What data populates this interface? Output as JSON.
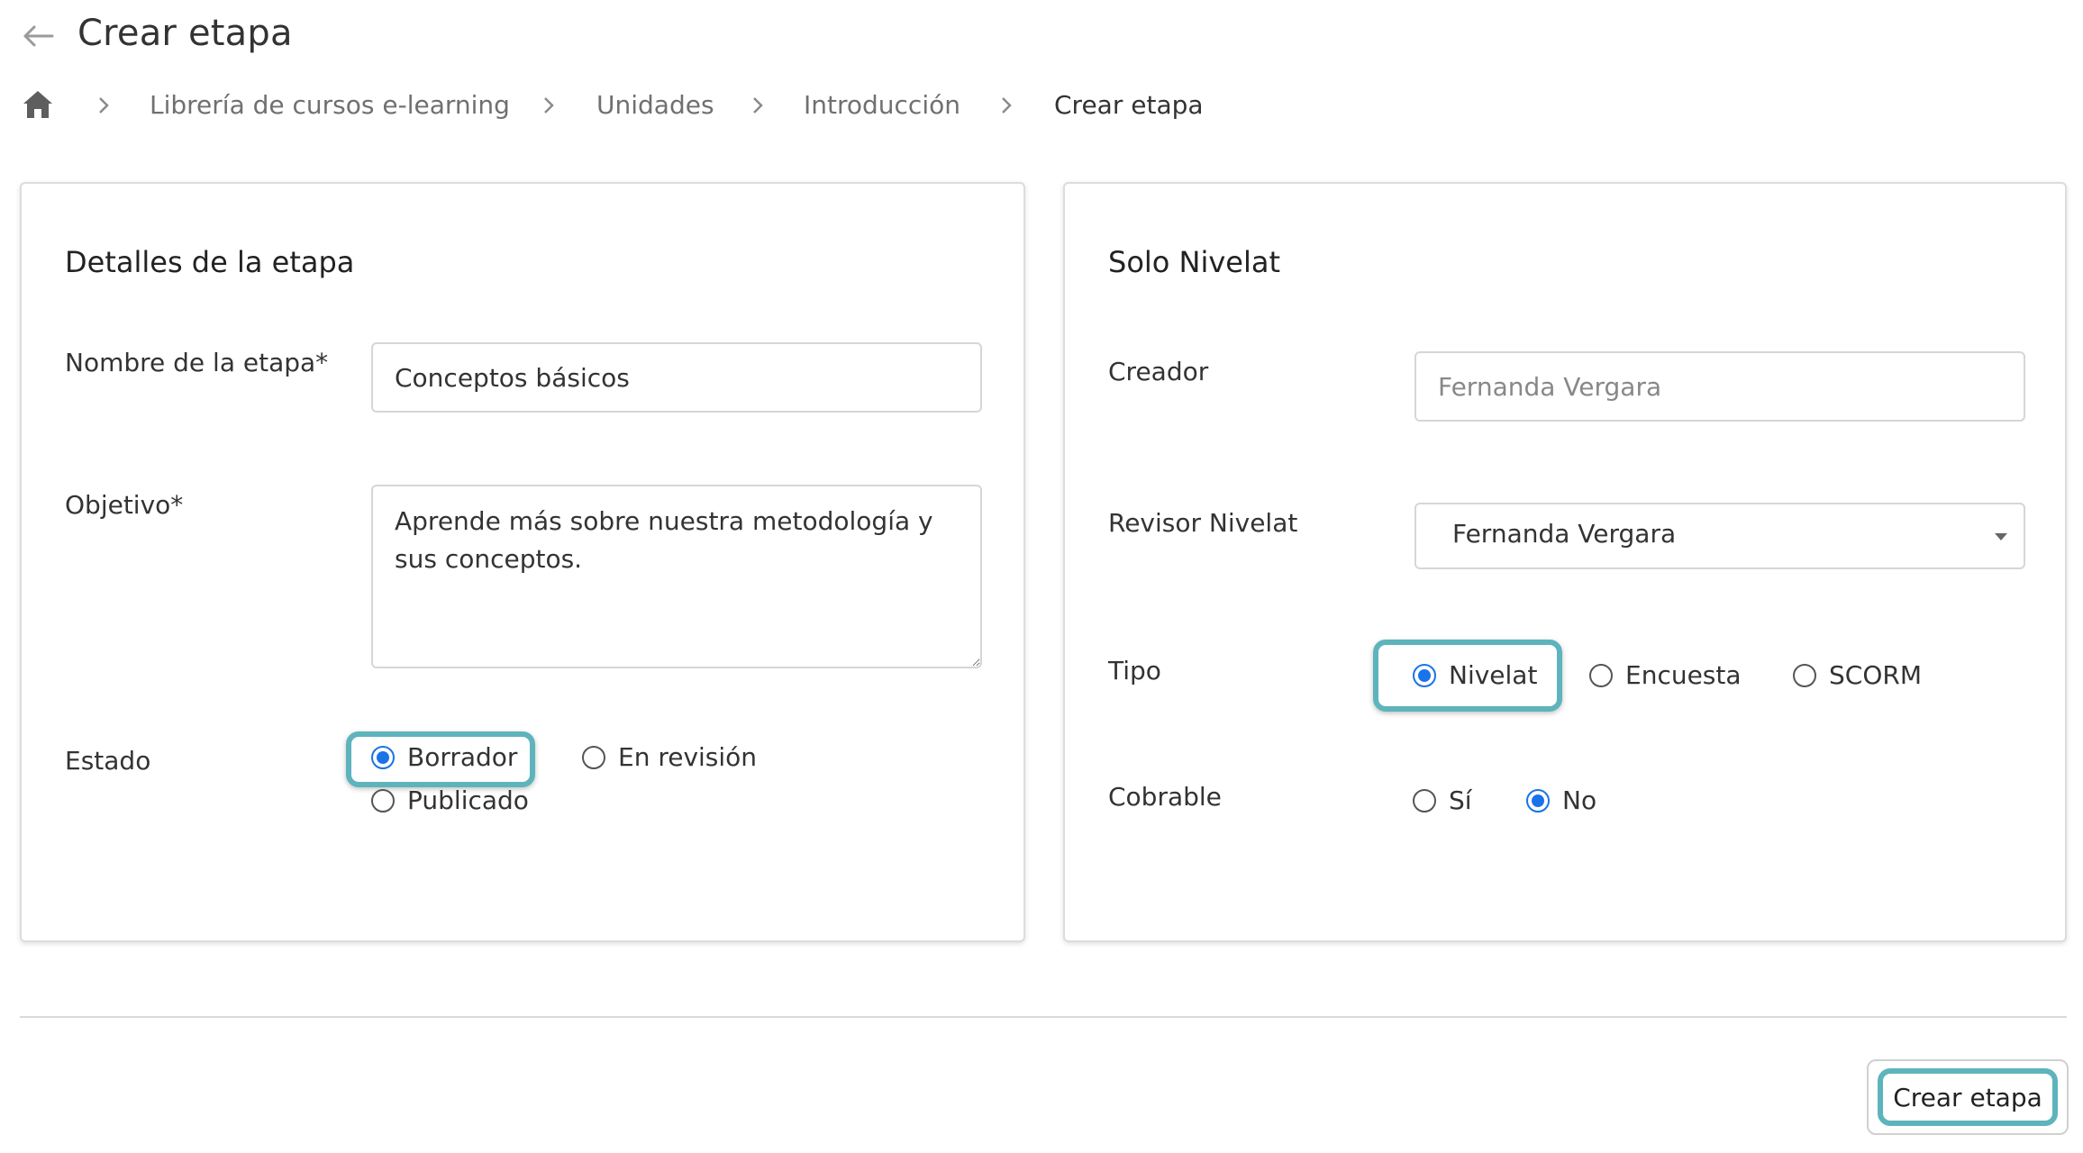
{
  "header": {
    "title": "Crear etapa"
  },
  "breadcrumb": {
    "items": [
      "Librería de cursos e-learning",
      "Unidades",
      "Introducción",
      "Crear etapa"
    ]
  },
  "details": {
    "title": "Detalles de la etapa",
    "name_label": "Nombre de la etapa*",
    "name_value": "Conceptos básicos",
    "objective_label": "Objetivo*",
    "objective_value": "Aprende más sobre nuestra metodología y sus conceptos.",
    "status_label": "Estado",
    "status_options": [
      {
        "label": "Borrador",
        "selected": true
      },
      {
        "label": "En revisión",
        "selected": false
      },
      {
        "label": "Publicado",
        "selected": false
      }
    ]
  },
  "nivelat": {
    "title": "Solo Nivelat",
    "creator_label": "Creador",
    "creator_value": "Fernanda Vergara",
    "reviewer_label": "Revisor Nivelat",
    "reviewer_value": "Fernanda Vergara",
    "type_label": "Tipo",
    "type_options": [
      {
        "label": "Nivelat",
        "selected": true
      },
      {
        "label": "Encuesta",
        "selected": false
      },
      {
        "label": "SCORM",
        "selected": false
      }
    ],
    "billable_label": "Cobrable",
    "billable_options": [
      {
        "label": "Sí",
        "selected": false
      },
      {
        "label": "No",
        "selected": true
      }
    ]
  },
  "footer": {
    "submit_label": "Crear etapa"
  },
  "colors": {
    "accent": "#1a73e8",
    "focus": "#5db4bc",
    "border": "#d6d6d6"
  },
  "icons": {
    "back": "arrow-left-icon",
    "home": "home-icon",
    "separator": "chevron-right-icon",
    "dropdown": "caret-down-icon"
  }
}
